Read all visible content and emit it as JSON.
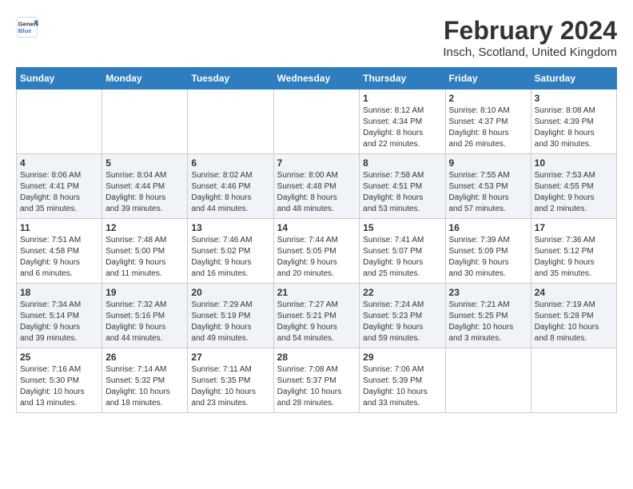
{
  "logo": {
    "line1": "General",
    "line2": "Blue"
  },
  "title": "February 2024",
  "subtitle": "Insch, Scotland, United Kingdom",
  "days_header": [
    "Sunday",
    "Monday",
    "Tuesday",
    "Wednesday",
    "Thursday",
    "Friday",
    "Saturday"
  ],
  "weeks": [
    [
      {
        "day": "",
        "info": ""
      },
      {
        "day": "",
        "info": ""
      },
      {
        "day": "",
        "info": ""
      },
      {
        "day": "",
        "info": ""
      },
      {
        "day": "1",
        "info": "Sunrise: 8:12 AM\nSunset: 4:34 PM\nDaylight: 8 hours\nand 22 minutes."
      },
      {
        "day": "2",
        "info": "Sunrise: 8:10 AM\nSunset: 4:37 PM\nDaylight: 8 hours\nand 26 minutes."
      },
      {
        "day": "3",
        "info": "Sunrise: 8:08 AM\nSunset: 4:39 PM\nDaylight: 8 hours\nand 30 minutes."
      }
    ],
    [
      {
        "day": "4",
        "info": "Sunrise: 8:06 AM\nSunset: 4:41 PM\nDaylight: 8 hours\nand 35 minutes."
      },
      {
        "day": "5",
        "info": "Sunrise: 8:04 AM\nSunset: 4:44 PM\nDaylight: 8 hours\nand 39 minutes."
      },
      {
        "day": "6",
        "info": "Sunrise: 8:02 AM\nSunset: 4:46 PM\nDaylight: 8 hours\nand 44 minutes."
      },
      {
        "day": "7",
        "info": "Sunrise: 8:00 AM\nSunset: 4:48 PM\nDaylight: 8 hours\nand 48 minutes."
      },
      {
        "day": "8",
        "info": "Sunrise: 7:58 AM\nSunset: 4:51 PM\nDaylight: 8 hours\nand 53 minutes."
      },
      {
        "day": "9",
        "info": "Sunrise: 7:55 AM\nSunset: 4:53 PM\nDaylight: 8 hours\nand 57 minutes."
      },
      {
        "day": "10",
        "info": "Sunrise: 7:53 AM\nSunset: 4:55 PM\nDaylight: 9 hours\nand 2 minutes."
      }
    ],
    [
      {
        "day": "11",
        "info": "Sunrise: 7:51 AM\nSunset: 4:58 PM\nDaylight: 9 hours\nand 6 minutes."
      },
      {
        "day": "12",
        "info": "Sunrise: 7:48 AM\nSunset: 5:00 PM\nDaylight: 9 hours\nand 11 minutes."
      },
      {
        "day": "13",
        "info": "Sunrise: 7:46 AM\nSunset: 5:02 PM\nDaylight: 9 hours\nand 16 minutes."
      },
      {
        "day": "14",
        "info": "Sunrise: 7:44 AM\nSunset: 5:05 PM\nDaylight: 9 hours\nand 20 minutes."
      },
      {
        "day": "15",
        "info": "Sunrise: 7:41 AM\nSunset: 5:07 PM\nDaylight: 9 hours\nand 25 minutes."
      },
      {
        "day": "16",
        "info": "Sunrise: 7:39 AM\nSunset: 5:09 PM\nDaylight: 9 hours\nand 30 minutes."
      },
      {
        "day": "17",
        "info": "Sunrise: 7:36 AM\nSunset: 5:12 PM\nDaylight: 9 hours\nand 35 minutes."
      }
    ],
    [
      {
        "day": "18",
        "info": "Sunrise: 7:34 AM\nSunset: 5:14 PM\nDaylight: 9 hours\nand 39 minutes."
      },
      {
        "day": "19",
        "info": "Sunrise: 7:32 AM\nSunset: 5:16 PM\nDaylight: 9 hours\nand 44 minutes."
      },
      {
        "day": "20",
        "info": "Sunrise: 7:29 AM\nSunset: 5:19 PM\nDaylight: 9 hours\nand 49 minutes."
      },
      {
        "day": "21",
        "info": "Sunrise: 7:27 AM\nSunset: 5:21 PM\nDaylight: 9 hours\nand 54 minutes."
      },
      {
        "day": "22",
        "info": "Sunrise: 7:24 AM\nSunset: 5:23 PM\nDaylight: 9 hours\nand 59 minutes."
      },
      {
        "day": "23",
        "info": "Sunrise: 7:21 AM\nSunset: 5:25 PM\nDaylight: 10 hours\nand 3 minutes."
      },
      {
        "day": "24",
        "info": "Sunrise: 7:19 AM\nSunset: 5:28 PM\nDaylight: 10 hours\nand 8 minutes."
      }
    ],
    [
      {
        "day": "25",
        "info": "Sunrise: 7:16 AM\nSunset: 5:30 PM\nDaylight: 10 hours\nand 13 minutes."
      },
      {
        "day": "26",
        "info": "Sunrise: 7:14 AM\nSunset: 5:32 PM\nDaylight: 10 hours\nand 18 minutes."
      },
      {
        "day": "27",
        "info": "Sunrise: 7:11 AM\nSunset: 5:35 PM\nDaylight: 10 hours\nand 23 minutes."
      },
      {
        "day": "28",
        "info": "Sunrise: 7:08 AM\nSunset: 5:37 PM\nDaylight: 10 hours\nand 28 minutes."
      },
      {
        "day": "29",
        "info": "Sunrise: 7:06 AM\nSunset: 5:39 PM\nDaylight: 10 hours\nand 33 minutes."
      },
      {
        "day": "",
        "info": ""
      },
      {
        "day": "",
        "info": ""
      }
    ]
  ]
}
